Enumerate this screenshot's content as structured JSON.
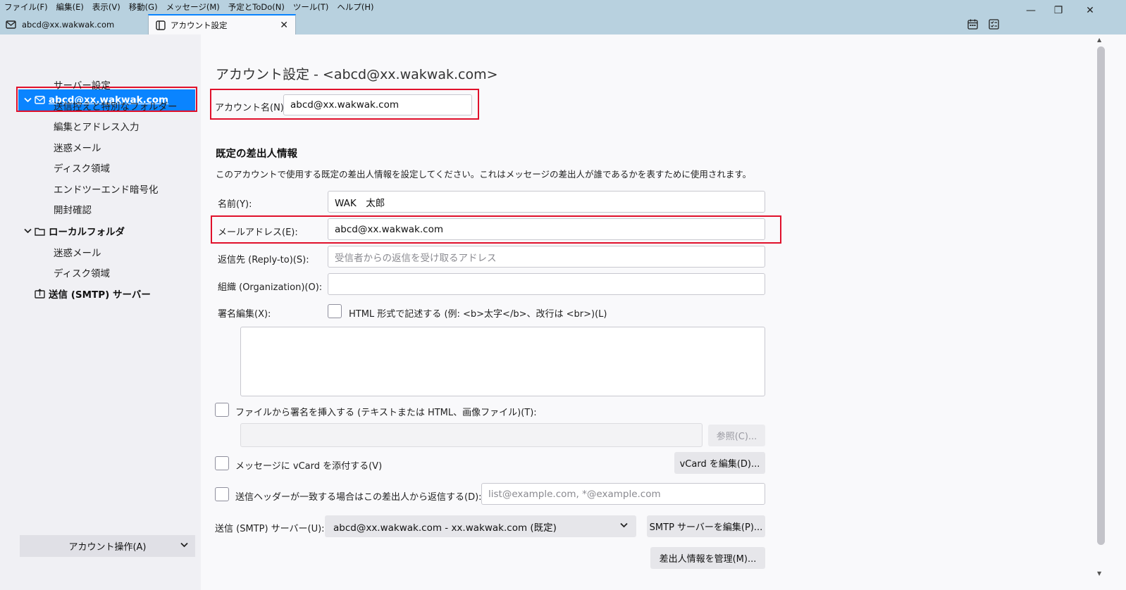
{
  "menubar": [
    "ファイル(F)",
    "編集(E)",
    "表示(V)",
    "移動(G)",
    "メッセージ(M)",
    "予定とToDo(N)",
    "ツール(T)",
    "ヘルプ(H)"
  ],
  "window": {
    "minimize": "—",
    "restore": "❐",
    "close": "✕"
  },
  "tabs": {
    "mail": "abcd@xx.wakwak.com",
    "settings": "アカウント設定",
    "close": "✕"
  },
  "sidebar": {
    "account": "abcd@xx.wakwak.com",
    "account_items": [
      "サーバー設定",
      "送信控えと特別なフォルダー",
      "編集とアドレス入力",
      "迷惑メール",
      "ディスク領域",
      "エンドツーエンド暗号化",
      "開封確認"
    ],
    "local_folder": "ローカルフォルダ",
    "local_items": [
      "迷惑メール",
      "ディスク領域"
    ],
    "smtp": "送信 (SMTP) サーバー",
    "account_actions": "アカウント操作(A)",
    "chevron": "⌄"
  },
  "main": {
    "title": "アカウント設定 - <abcd@xx.wakwak.com>",
    "account_name_label": "アカウント名(N):",
    "account_name_value": "abcd@xx.wakwak.com",
    "identity_title": "既定の差出人情報",
    "identity_desc": "このアカウントで使用する既定の差出人情報を設定してください。これはメッセージの差出人が誰であるかを表すために使用されます。",
    "name_label": "名前(Y):",
    "name_value": "WAK　太郎",
    "email_label": "メールアドレス(E):",
    "email_value": "abcd@xx.wakwak.com",
    "replyto_label": "返信先 (Reply-to)(S):",
    "replyto_placeholder": "受信者からの返信を受け取るアドレス",
    "org_label": "組織 (Organization)(O):",
    "org_value": "",
    "sig_label": "署名編集(X):",
    "html_checkbox_label": "HTML 形式で記述する (例: <b>太字</b>、改行は <br>)(L)",
    "sig_file_label": "ファイルから署名を挿入する (テキストまたは HTML、画像ファイル)(T):",
    "browse_button": "参照(C)...",
    "vcard_label": "メッセージに vCard を添付する(V)",
    "vcard_button": "vCard を編集(D)...",
    "reply_from_label": "送信ヘッダーが一致する場合はこの差出人から返信する(D):",
    "reply_from_placeholder": "list@example.com, *@example.com",
    "smtp_label": "送信 (SMTP) サーバー(U):",
    "smtp_value": "abcd@xx.wakwak.com - xx.wakwak.com (既定)",
    "smtp_edit_button": "SMTP サーバーを編集(P)...",
    "manage_identities_button": "差出人情報を管理(M)...",
    "chevron": "⌄"
  }
}
